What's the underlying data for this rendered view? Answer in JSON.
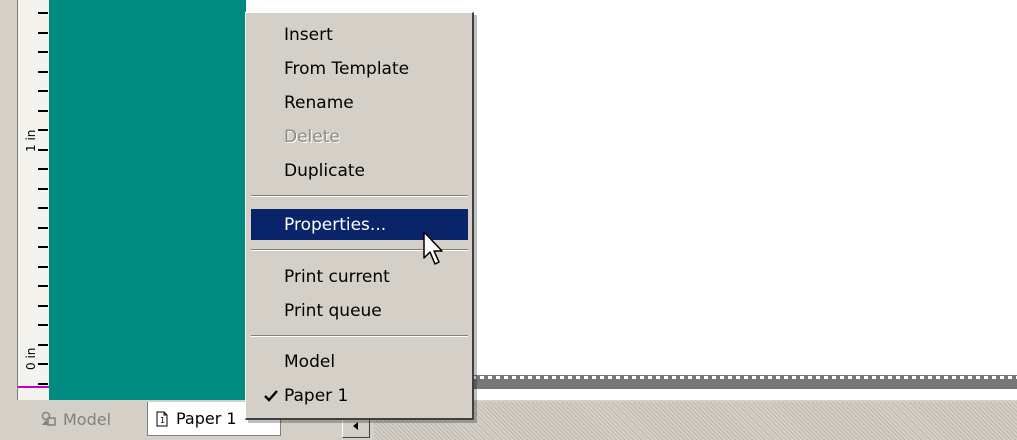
{
  "ruler": {
    "label_1in": "1 in",
    "label_0in": "0 in"
  },
  "tabs": [
    {
      "label": "Model",
      "icon": "model-icon",
      "active": false
    },
    {
      "label": "Paper 1",
      "icon": "page-icon",
      "active": true
    }
  ],
  "context_menu": {
    "items": [
      {
        "label": "Insert",
        "enabled": true
      },
      {
        "label": "From Template",
        "enabled": true
      },
      {
        "label": "Rename",
        "enabled": true
      },
      {
        "label": "Delete",
        "enabled": false
      },
      {
        "label": "Duplicate",
        "enabled": true
      },
      {
        "label": "Properties...",
        "enabled": true,
        "highlighted": true
      },
      {
        "label": "Print current",
        "enabled": true
      },
      {
        "label": "Print queue",
        "enabled": true
      },
      {
        "label": "Model",
        "enabled": true
      },
      {
        "label": "Paper 1",
        "enabled": true,
        "checked": true
      }
    ]
  },
  "colors": {
    "canvas": "#008b80",
    "menu_background": "#d4d0c8",
    "menu_highlight": "#0a246a",
    "origin_line": "#c000c0"
  }
}
